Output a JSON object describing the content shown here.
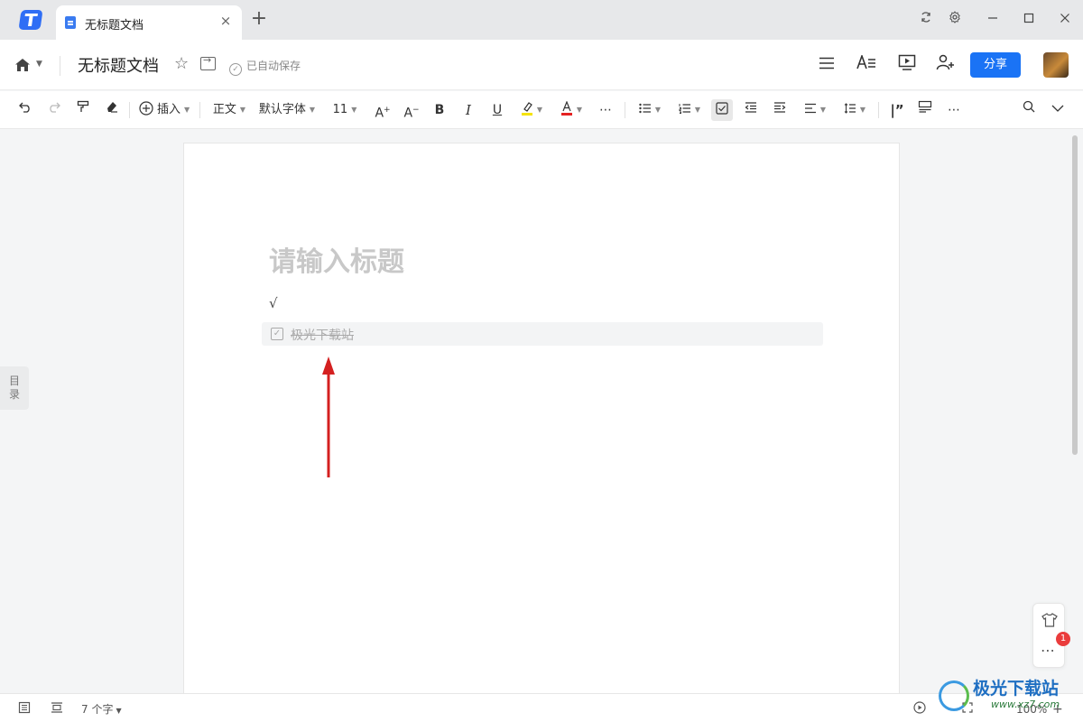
{
  "tabbar": {
    "tab_title": "无标题文档",
    "close_glyph": "×",
    "add_glyph": "+"
  },
  "header": {
    "doc_title": "无标题文档",
    "save_status": "已自动保存",
    "share_label": "分享"
  },
  "toolbar": {
    "insert_label": "插入",
    "style_label": "正文",
    "font_label": "默认字体",
    "size_label": "11",
    "more_glyph": "⋯"
  },
  "document": {
    "title_placeholder": "请输入标题",
    "line1": "√",
    "task_text": "极光下载站"
  },
  "sidebar": {
    "toc_label_1": "目",
    "toc_label_2": "录"
  },
  "float_panel": {
    "badge_count": "1",
    "more_glyph": "⋯"
  },
  "statusbar": {
    "word_count": "7 个字",
    "zoom": "100%",
    "plus_glyph": "+"
  },
  "watermark": {
    "text": "极光下载站",
    "url": "www.xz7.com"
  },
  "colors": {
    "accent": "#1a73f5",
    "arrow": "#d42020",
    "badge": "#ea3c3c"
  }
}
